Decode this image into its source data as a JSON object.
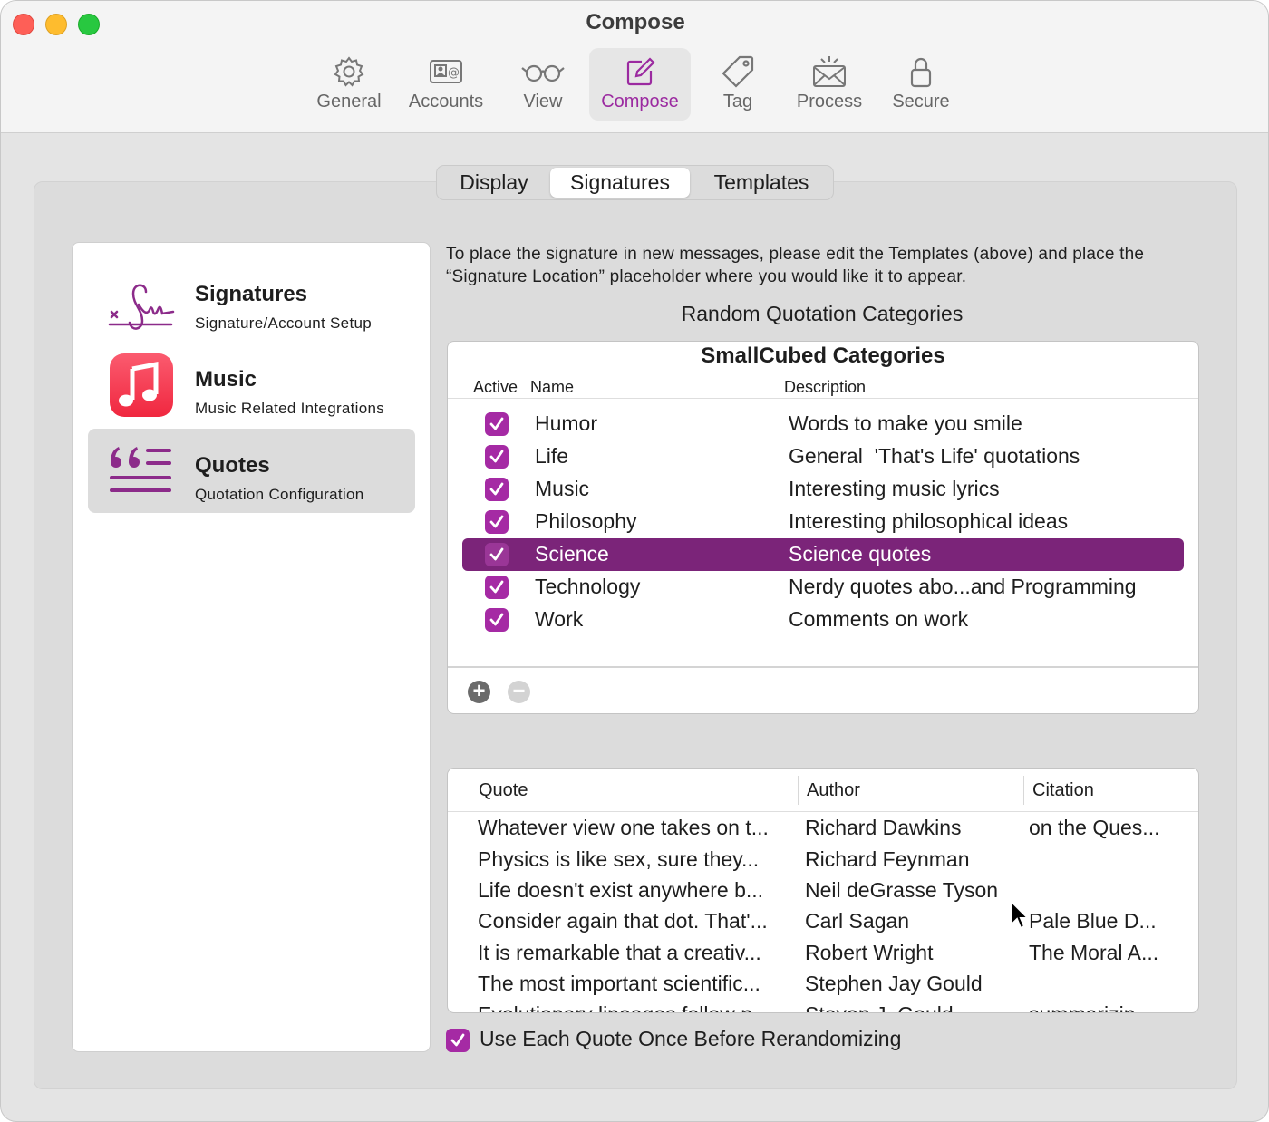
{
  "window": {
    "title": "Compose"
  },
  "toolbar": {
    "items": [
      {
        "label": "General",
        "icon": "gear-icon"
      },
      {
        "label": "Accounts",
        "icon": "contact-card-icon"
      },
      {
        "label": "View",
        "icon": "glasses-icon"
      },
      {
        "label": "Compose",
        "icon": "compose-icon",
        "active": true
      },
      {
        "label": "Tag",
        "icon": "tag-icon"
      },
      {
        "label": "Process",
        "icon": "envelope-sparkle-icon"
      },
      {
        "label": "Secure",
        "icon": "lock-icon"
      }
    ]
  },
  "segments": {
    "items": [
      "Display",
      "Signatures",
      "Templates"
    ],
    "selected": "Signatures"
  },
  "sidebar": {
    "items": [
      {
        "title": "Signatures",
        "subtitle": "Signature/Account Setup",
        "icon": "signature-icon"
      },
      {
        "title": "Music",
        "subtitle": "Music Related Integrations",
        "icon": "music-note-icon"
      },
      {
        "title": "Quotes",
        "subtitle": "Quotation Configuration",
        "icon": "quote-icon",
        "selected": true
      }
    ]
  },
  "info_text": "To place the signature in new messages, please edit the Templates (above) and place the “Signature Location” placeholder where you would like it to appear.",
  "categories": {
    "section_title": "Random Quotation Categories",
    "table_title": "SmallCubed Categories",
    "headers": {
      "active": "Active",
      "name": "Name",
      "description": "Description"
    },
    "rows": [
      {
        "name": "Humor",
        "description": "Words to make you smile",
        "active": true
      },
      {
        "name": "Life",
        "description": "General  'That's Life' quotations",
        "active": true
      },
      {
        "name": "Music",
        "description": "Interesting music lyrics",
        "active": true
      },
      {
        "name": "Philosophy",
        "description": "Interesting philosophical ideas",
        "active": true
      },
      {
        "name": "Science",
        "description": "Science quotes",
        "active": true,
        "selected": true
      },
      {
        "name": "Technology",
        "description": "Nerdy quotes abo...and Programming",
        "active": true
      },
      {
        "name": "Work",
        "description": "Comments on work",
        "active": true
      }
    ]
  },
  "quotes": {
    "headers": {
      "quote": "Quote",
      "author": "Author",
      "citation": "Citation"
    },
    "rows": [
      {
        "quote": "Whatever view one takes on t...",
        "author": "Richard Dawkins",
        "citation": "on the Ques..."
      },
      {
        "quote": "Physics is like sex, sure they...",
        "author": "Richard Feynman",
        "citation": ""
      },
      {
        "quote": "Life doesn't exist anywhere b...",
        "author": "Neil deGrasse Tyson",
        "citation": ""
      },
      {
        "quote": "Consider again that dot. That'...",
        "author": "Carl Sagan",
        "citation": "Pale Blue D..."
      },
      {
        "quote": "It is remarkable that a creativ...",
        "author": "Robert Wright",
        "citation": "The Moral A..."
      },
      {
        "quote": "The most important scientific...",
        "author": "Stephen Jay Gould",
        "citation": ""
      },
      {
        "quote": "Evolutionary lineages follow n...",
        "author": "Steven J. Gould",
        "citation": "summarizin..."
      }
    ]
  },
  "use_each_quote": {
    "label": "Use Each Quote Once Before Rerandomizing",
    "checked": true
  },
  "colors": {
    "accent": "#a52aa4",
    "selection": "#7b2479",
    "active_tab_text": "#9b2aa0"
  }
}
